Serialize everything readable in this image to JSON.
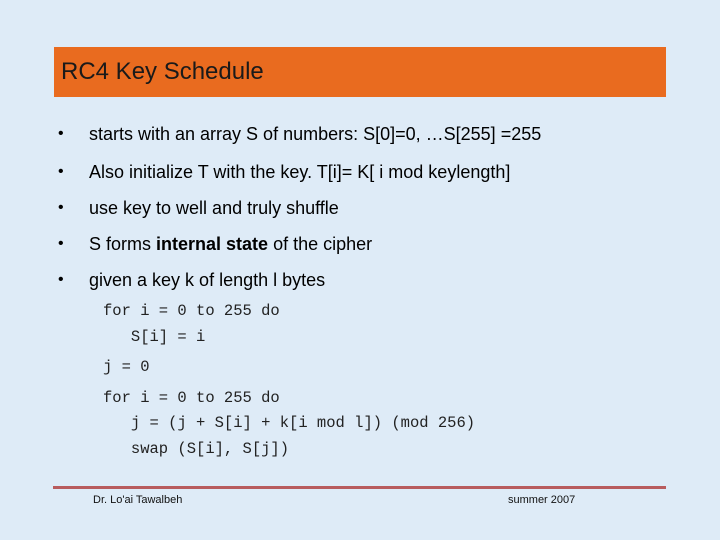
{
  "slide": {
    "title": "RC4 Key Schedule",
    "colors": {
      "title_bar": "#e96b1f",
      "background": "#deebf7",
      "footer_rule": "#b85c5e"
    },
    "bullet_glyph": "•",
    "bullets": [
      {
        "text": "starts with an array S of numbers: S[0]=0, …S[255] =255"
      },
      {
        "text": "Also initialize T with the key. T[i]= K[ i mod keylength]"
      },
      {
        "text": "use key to well and truly shuffle"
      },
      {
        "pre": "S forms ",
        "bold": "internal state",
        "post": " of the cipher"
      },
      {
        "text": "given a key k of length l bytes"
      }
    ],
    "code_lines": [
      "for i = 0 to 255 do",
      "   S[i] = i",
      "j = 0",
      "for i = 0 to 255 do",
      "   j = (j + S[i] + k[i mod l]) (mod 256)",
      "   swap (S[i], S[j])"
    ],
    "footer": {
      "left": "Dr. Lo'ai Tawalbeh",
      "right": "summer 2007"
    }
  }
}
